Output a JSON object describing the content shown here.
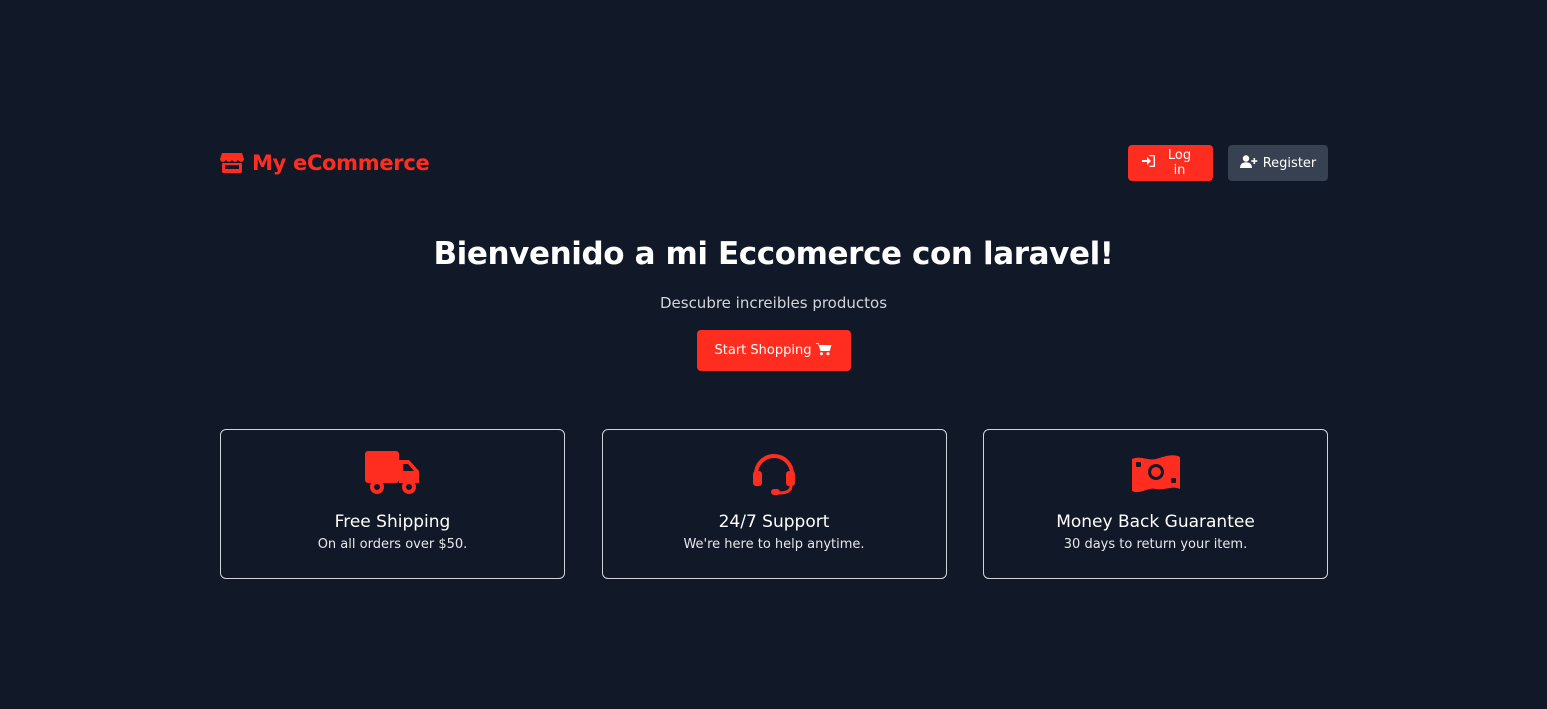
{
  "header": {
    "brand": "My eCommerce",
    "brand_icon": "store-icon",
    "login_label": "Log in",
    "login_icon": "sign-in-icon",
    "register_label": "Register",
    "register_icon": "user-plus-icon"
  },
  "hero": {
    "title": "Bienvenido a mi Eccomerce con laravel!",
    "subtitle": "Descubre increibles productos",
    "cta_label": "Start Shopping",
    "cta_icon": "cart-icon"
  },
  "features": [
    {
      "icon": "truck-icon",
      "title": "Free Shipping",
      "description": "On all orders over $50."
    },
    {
      "icon": "headset-icon",
      "title": "24/7 Support",
      "description": "We're here to help anytime."
    },
    {
      "icon": "money-bill-icon",
      "title": "Money Back Guarantee",
      "description": "30 days to return your item."
    }
  ],
  "colors": {
    "background": "#111827",
    "accent": "#ff2d20",
    "secondary_button": "#374151",
    "card_border": "#d1d5db"
  }
}
